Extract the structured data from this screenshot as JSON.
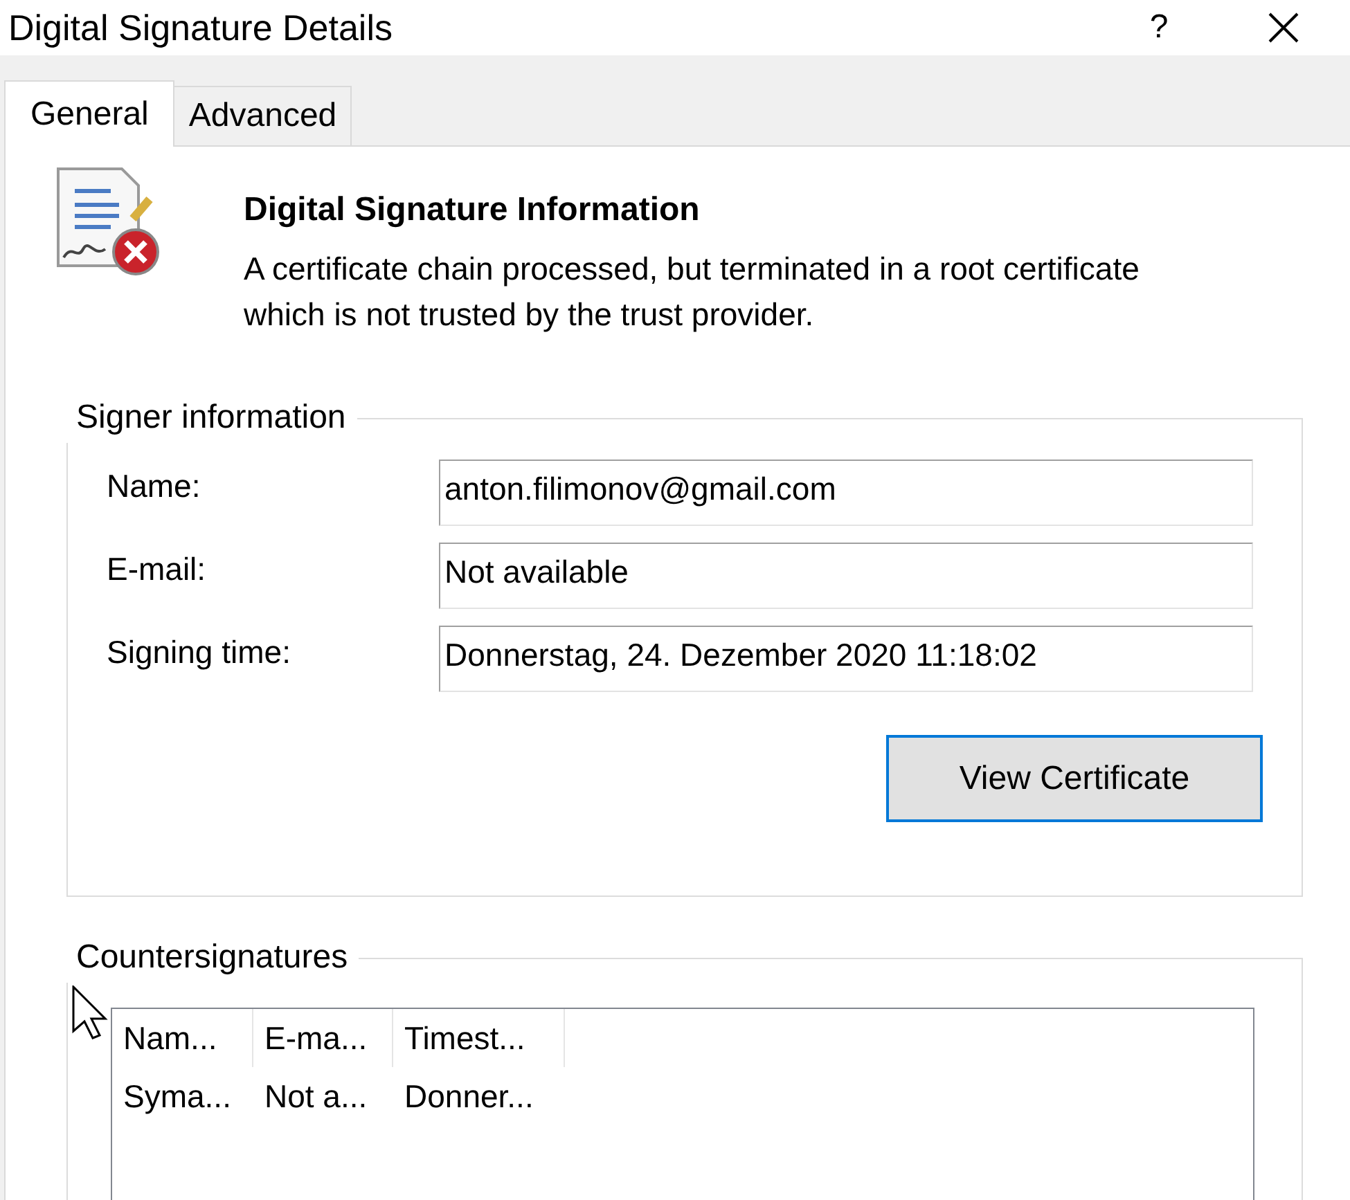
{
  "window": {
    "title": "Digital Signature Details",
    "help": "?"
  },
  "tabs": [
    {
      "label": "General",
      "selected": true
    },
    {
      "label": "Advanced",
      "selected": false
    }
  ],
  "info": {
    "heading": "Digital Signature Information",
    "message": "A certificate chain processed, but terminated in a root certificate which is not trusted by the trust provider."
  },
  "signer": {
    "title": "Signer information",
    "fields": [
      {
        "label": "Name:",
        "value": "anton.filimonov@gmail.com"
      },
      {
        "label": "E-mail:",
        "value": "Not available"
      },
      {
        "label": "Signing time:",
        "value": "Donnerstag, 24. Dezember 2020 11:18:02"
      }
    ],
    "button": "View Certificate"
  },
  "countersignatures": {
    "title": "Countersignatures",
    "columns": [
      "Nam...",
      "E-ma...",
      "Timest..."
    ],
    "rows": [
      [
        "Syma...",
        "Not a...",
        "Donner..."
      ]
    ]
  }
}
